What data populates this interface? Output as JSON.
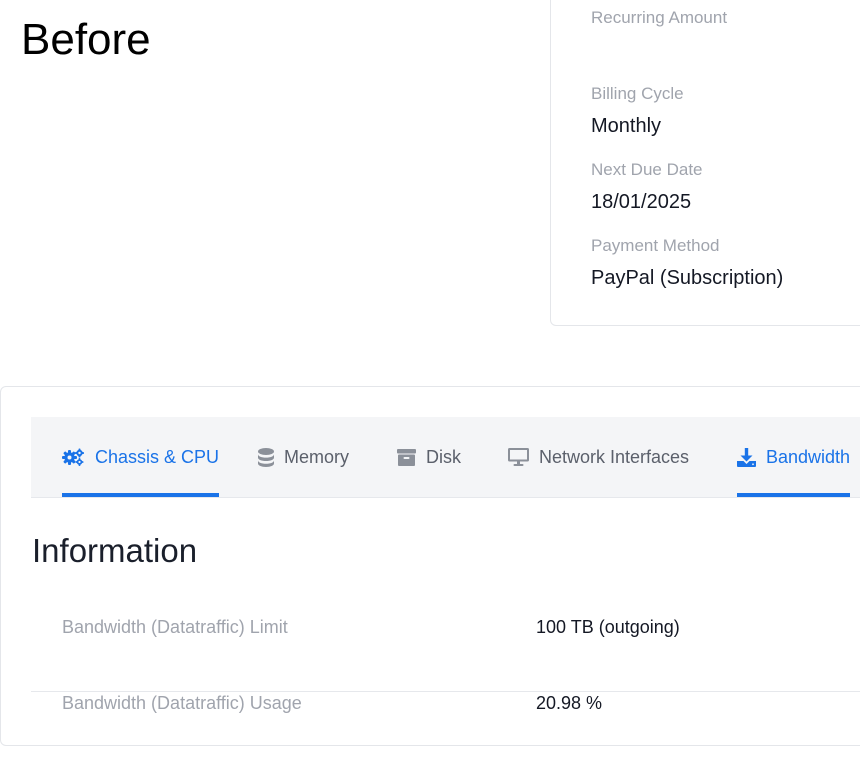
{
  "caption": "Before",
  "billing": {
    "recurring_amount": {
      "label": "Recurring Amount",
      "value": ""
    },
    "billing_cycle": {
      "label": "Billing Cycle",
      "value": "Monthly"
    },
    "next_due_date": {
      "label": "Next Due Date",
      "value": "18/01/2025"
    },
    "payment_method": {
      "label": "Payment Method",
      "value": "PayPal (Subscription)"
    }
  },
  "tabs": [
    {
      "label": "Chassis & CPU",
      "icon": "gears-icon",
      "active": true
    },
    {
      "label": "Memory",
      "icon": "database-icon",
      "active": false
    },
    {
      "label": "Disk",
      "icon": "archive-icon",
      "active": false
    },
    {
      "label": "Network Interfaces",
      "icon": "monitor-icon",
      "active": false
    },
    {
      "label": "Bandwidth",
      "icon": "download-icon",
      "active": true
    }
  ],
  "info": {
    "title": "Information",
    "rows": [
      {
        "label": "Bandwidth (Datatraffic) Limit",
        "value": "100 TB (outgoing)"
      },
      {
        "label": "Bandwidth (Datatraffic) Usage",
        "value": "20.98 %"
      }
    ]
  },
  "colors": {
    "accent": "#1a73e8",
    "tab_bar_bg": "#f4f5f7",
    "muted_text": "#a0a4ad",
    "border": "#e4e6ea"
  }
}
